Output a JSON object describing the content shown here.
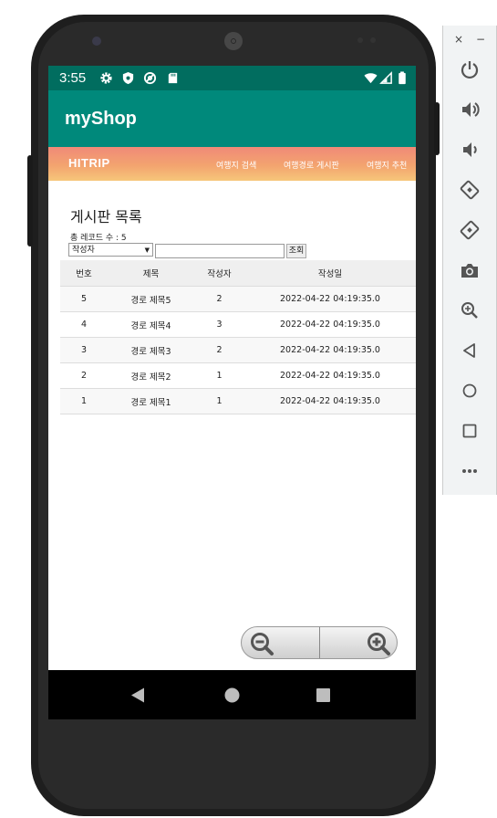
{
  "status_bar": {
    "time": "3:55"
  },
  "app_bar": {
    "title": "myShop"
  },
  "banner": {
    "brand": "HITRIP",
    "nav": [
      "여행지 검색",
      "여행경로 게시판",
      "여행지 추천"
    ]
  },
  "board": {
    "title": "게시판 목록",
    "record_count": "총 레코드 수 : 5",
    "search_select": "작성자",
    "search_input": "",
    "search_button": "조회",
    "columns": [
      "번호",
      "제목",
      "작성자",
      "작성일"
    ],
    "rows": [
      [
        "5",
        "경로 제목5",
        "2",
        "2022-04-22 04:19:35.0"
      ],
      [
        "4",
        "경로 제목4",
        "3",
        "2022-04-22 04:19:35.0"
      ],
      [
        "3",
        "경로 제목3",
        "2",
        "2022-04-22 04:19:35.0"
      ],
      [
        "2",
        "경로 제목2",
        "1",
        "2022-04-22 04:19:35.0"
      ],
      [
        "1",
        "경로 제목1",
        "1",
        "2022-04-22 04:19:35.0"
      ]
    ]
  },
  "zoom_controls": {
    "out_icon": "zoom-out-icon",
    "in_icon": "zoom-in-icon"
  },
  "android_nav": [
    "back-icon",
    "home-icon",
    "recents-icon"
  ],
  "emulator_sidebar": {
    "close": "×",
    "minimize": "−",
    "icons": [
      "power-icon",
      "volume-up-icon",
      "volume-down-icon",
      "rotate-left-icon",
      "rotate-right-icon",
      "camera-icon",
      "zoom-icon",
      "back-icon",
      "home-icon",
      "overview-icon",
      "more-icon"
    ]
  },
  "colors": {
    "status_bar": "#016d5f",
    "app_bar": "#00897b",
    "banner_start": "#f08a78",
    "banner_end": "#f6c67a"
  }
}
